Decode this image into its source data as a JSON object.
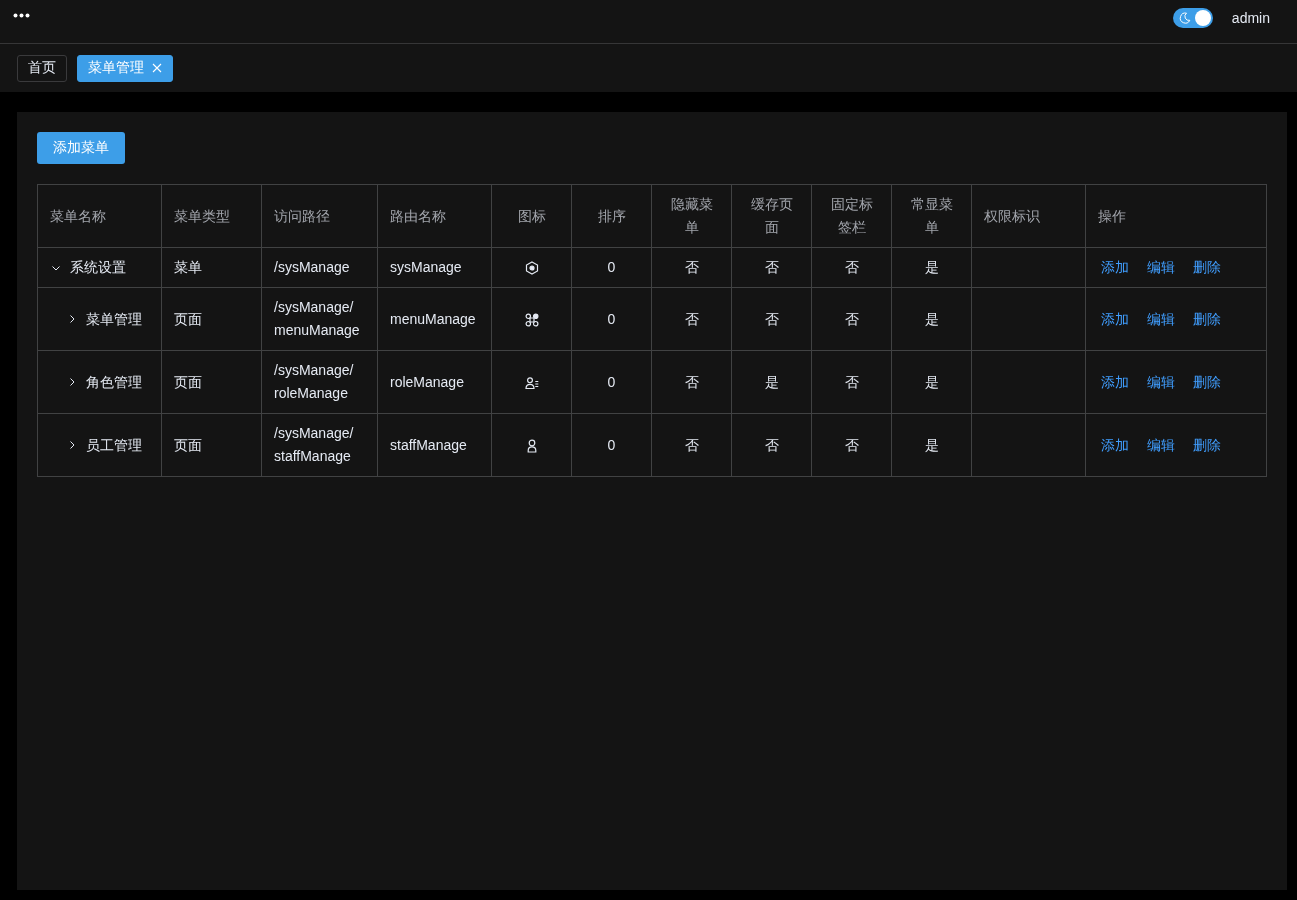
{
  "header": {
    "theme_switch": {
      "on": true
    },
    "user": "admin"
  },
  "tabs": [
    {
      "label": "首页",
      "selected": false,
      "closable": false
    },
    {
      "label": "菜单管理",
      "selected": true,
      "closable": true
    }
  ],
  "add_button": "添加菜单",
  "table": {
    "columns": [
      "菜单名称",
      "菜单类型",
      "访问路径",
      "路由名称",
      "图标",
      "排序",
      "隐藏菜单",
      "缓存页面",
      "固定标签栏",
      "常显菜单",
      "权限标识",
      "操作"
    ],
    "rows": [
      {
        "name": "系统设置",
        "type": "菜单",
        "path": "/sysManage",
        "route_name": "sysManage",
        "sort": "0",
        "hidden": "否",
        "cache": "否",
        "fixed_tab": "否",
        "always_show": "是",
        "actions": [
          "添加",
          "编辑",
          "删除"
        ],
        "expanded": true,
        "children": [
          {
            "name": "菜单管理",
            "type": "页面",
            "path": "/sysManage/menuManage",
            "route_name": "menuManage",
            "sort": "0",
            "hidden": "否",
            "cache": "否",
            "fixed_tab": "否",
            "always_show": "是",
            "actions": [
              "添加",
              "编辑",
              "删除"
            ],
            "expanded": false
          },
          {
            "name": "角色管理",
            "type": "页面",
            "path": "/sysManage/roleManage",
            "route_name": "roleManage",
            "sort": "0",
            "hidden": "否",
            "cache": "是",
            "fixed_tab": "否",
            "always_show": "是",
            "actions": [
              "添加",
              "编辑",
              "删除"
            ],
            "expanded": false
          },
          {
            "name": "员工管理",
            "type": "页面",
            "path": "/sysManage/staffManage",
            "route_name": "staffManage",
            "sort": "0",
            "hidden": "否",
            "cache": "否",
            "fixed_tab": "否",
            "always_show": "是",
            "actions": [
              "添加",
              "编辑",
              "删除"
            ],
            "expanded": false
          }
        ]
      }
    ]
  }
}
